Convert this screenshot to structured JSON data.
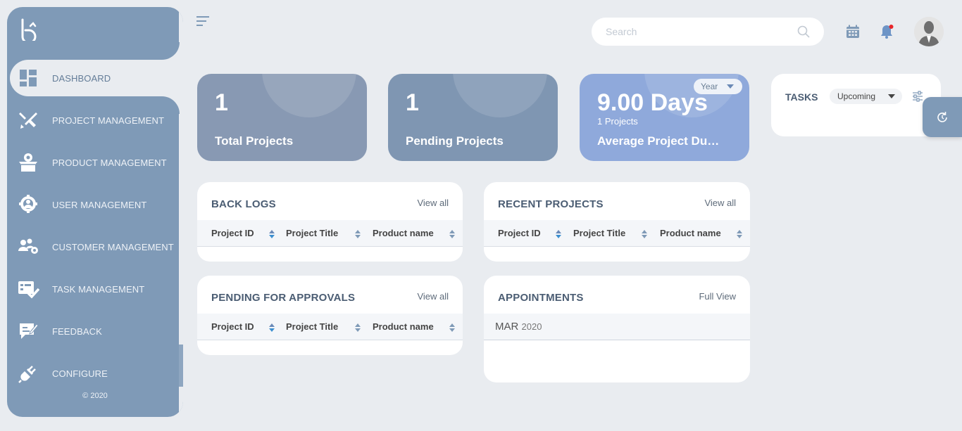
{
  "sidebar": {
    "items": [
      {
        "label": "DASHBOARD",
        "icon": "dashboard-icon"
      },
      {
        "label": "PROJECT MANAGEMENT",
        "icon": "tools-icon"
      },
      {
        "label": "PRODUCT MANAGEMENT",
        "icon": "box-gear-icon"
      },
      {
        "label": "USER MANAGEMENT",
        "icon": "user-gear-icon"
      },
      {
        "label": "CUSTOMER MANAGEMENT",
        "icon": "customers-icon"
      },
      {
        "label": "TASK MANAGEMENT",
        "icon": "task-check-icon"
      },
      {
        "label": "FEEDBACK",
        "icon": "feedback-icon"
      },
      {
        "label": "CONFIGURE",
        "icon": "plug-icon"
      }
    ],
    "copyright": "© 2020"
  },
  "search": {
    "placeholder": "Search",
    "value": ""
  },
  "stats": [
    {
      "value": "1",
      "label": "Total Projects"
    },
    {
      "value": "1",
      "label": "Pending Projects"
    },
    {
      "value": "9.00 Days",
      "sub": "1 Projects",
      "label": "Average Project Duration",
      "filter": "Year"
    }
  ],
  "tasks": {
    "title": "TASKS",
    "filter": "Upcoming"
  },
  "backlogs": {
    "title": "BACK LOGS",
    "view": "View all",
    "columns": [
      "Project ID",
      "Project Title",
      "Product name"
    ]
  },
  "recent": {
    "title": "RECENT PROJECTS",
    "view": "View all",
    "columns": [
      "Project ID",
      "Project Title",
      "Product name"
    ]
  },
  "pending": {
    "title": "PENDING FOR APPROVALS",
    "view": "View all",
    "columns": [
      "Project ID",
      "Project Title",
      "Product name"
    ]
  },
  "appointments": {
    "title": "APPOINTMENTS",
    "view": "Full View",
    "month": "MAR",
    "year": "2020"
  },
  "colors": {
    "sidebar": "#7f9ab7",
    "card1": "#8899b3",
    "card2": "#7f96b2",
    "card3": "#8fa9db",
    "background": "#e9ecf0"
  }
}
